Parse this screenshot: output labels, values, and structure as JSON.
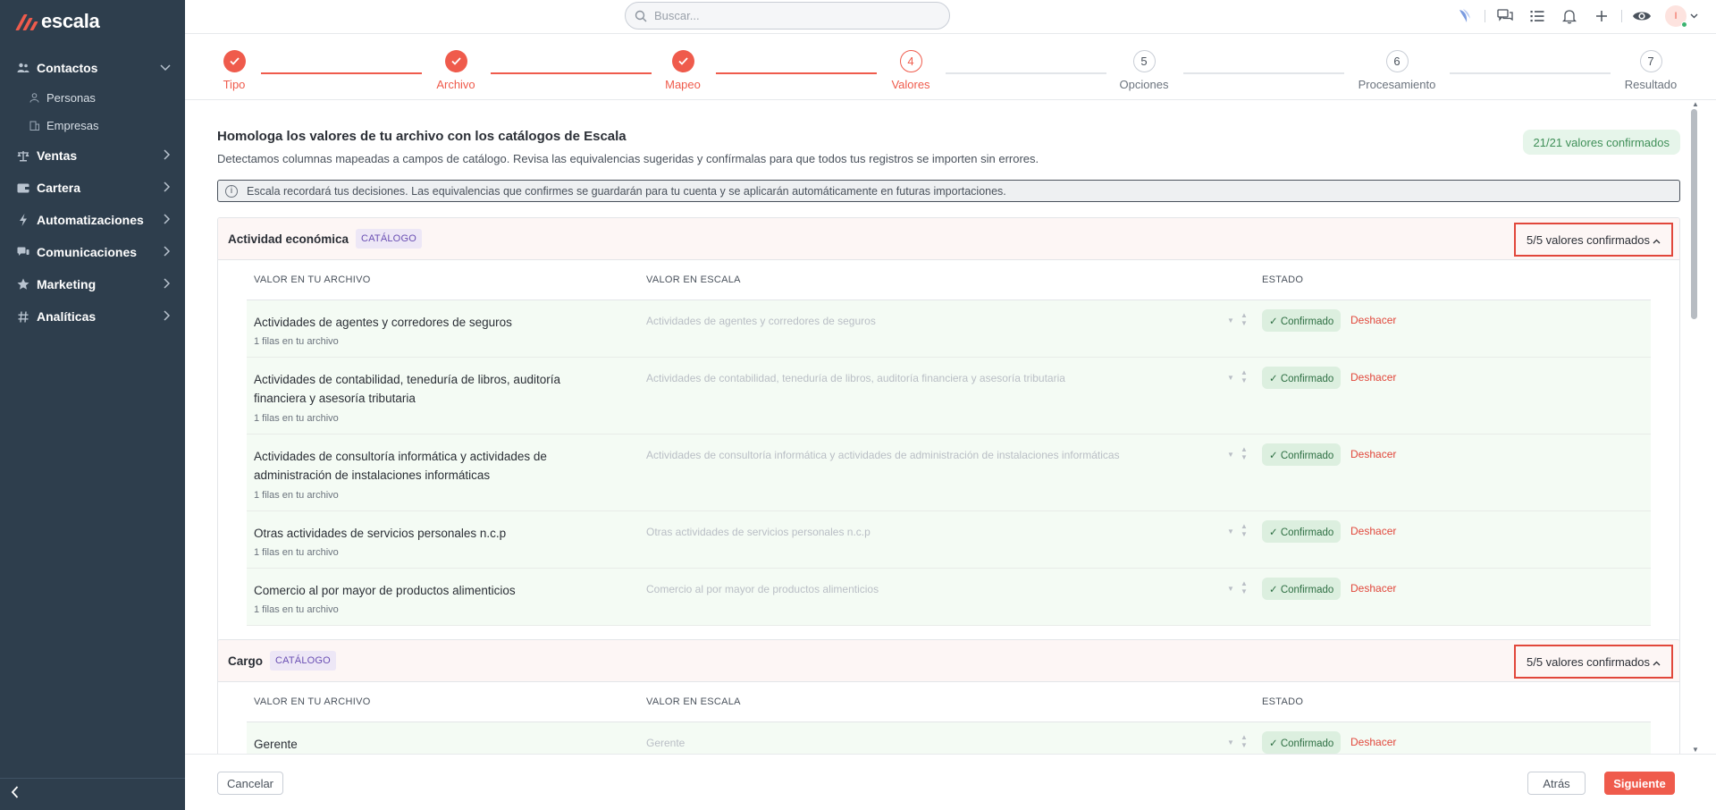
{
  "app": {
    "logo_text": "escala"
  },
  "sidebar": {
    "items": [
      {
        "label": "Contactos",
        "icon": "people-icon",
        "expanded": true,
        "children": [
          {
            "label": "Personas",
            "icon": "person-icon"
          },
          {
            "label": "Empresas",
            "icon": "building-icon"
          }
        ]
      },
      {
        "label": "Ventas",
        "icon": "scale-icon"
      },
      {
        "label": "Cartera",
        "icon": "wallet-icon"
      },
      {
        "label": "Automatizaciones",
        "icon": "bolt-icon"
      },
      {
        "label": "Comunicaciones",
        "icon": "chat-icon"
      },
      {
        "label": "Marketing",
        "icon": "star-icon"
      },
      {
        "label": "Analíticas",
        "icon": "hash-icon"
      }
    ]
  },
  "topbar": {
    "search_placeholder": "Buscar...",
    "avatar_initial": "I"
  },
  "stepper": {
    "steps": [
      {
        "number": "1",
        "label": "Tipo",
        "state": "done"
      },
      {
        "number": "2",
        "label": "Archivo",
        "state": "done"
      },
      {
        "number": "3",
        "label": "Mapeo",
        "state": "done"
      },
      {
        "number": "4",
        "label": "Valores",
        "state": "active"
      },
      {
        "number": "5",
        "label": "Opciones",
        "state": "todo"
      },
      {
        "number": "6",
        "label": "Procesamiento",
        "state": "todo"
      },
      {
        "number": "7",
        "label": "Resultado",
        "state": "todo"
      }
    ]
  },
  "main": {
    "heading": "Homologa los valores de tu archivo con los catálogos de Escala",
    "description": "Detectamos columnas mapeadas a campos de catálogo. Revisa las equivalencias sugeridas y confírmalas para que todos tus registros se importen sin errores.",
    "total_confirmed": "21/21 valores confirmados",
    "info": "Escala recordará tus decisiones. Las equivalencias que confirmes se guardarán para tu cuenta y se aplicarán automáticamente en futuras importaciones.",
    "columns": {
      "file_value": "VALOR EN TU ARCHIVO",
      "escala_value": "VALOR EN ESCALA",
      "status": "ESTADO"
    },
    "status_label": "✓ Confirmado",
    "undo_label": "Deshacer",
    "catalog_badge": "CATÁLOGO",
    "sections": [
      {
        "title": "Actividad económica",
        "confirmed": "5/5 valores confirmados",
        "rows": [
          {
            "value": "Actividades de agentes y corredores de seguros",
            "rows_count": "1 filas en tu archivo",
            "mapped": "Actividades de agentes y corredores de seguros"
          },
          {
            "value": "Actividades de contabilidad, teneduría de libros, auditoría financiera y asesoría tributaria",
            "rows_count": "1 filas en tu archivo",
            "mapped": "Actividades de contabilidad, teneduría de libros, auditoría financiera y asesoría tributaria"
          },
          {
            "value": "Actividades de consultoría informática y actividades de administración de instalaciones informáticas",
            "rows_count": "1 filas en tu archivo",
            "mapped": "Actividades de consultoría informática y actividades de administración de instalaciones informáticas"
          },
          {
            "value": "Otras actividades de servicios personales n.c.p",
            "rows_count": "1 filas en tu archivo",
            "mapped": "Otras actividades de servicios personales n.c.p"
          },
          {
            "value": "Comercio al por mayor de productos alimenticios",
            "rows_count": "1 filas en tu archivo",
            "mapped": "Comercio al por mayor de productos alimenticios"
          }
        ]
      },
      {
        "title": "Cargo",
        "confirmed": "5/5 valores confirmados",
        "rows": [
          {
            "value": "Gerente",
            "rows_count": "",
            "mapped": "Gerente"
          }
        ]
      }
    ]
  },
  "footer": {
    "cancel": "Cancelar",
    "back": "Atrás",
    "next": "Siguiente"
  },
  "colors": {
    "accent": "#ef5b4c",
    "sidebar": "#2e3e4d",
    "confirmed_bg": "#dcefdf"
  }
}
